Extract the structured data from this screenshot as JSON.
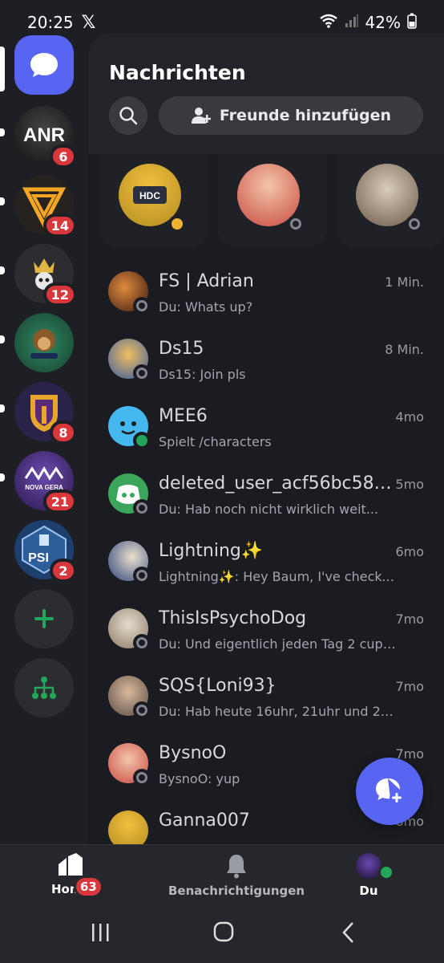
{
  "status_bar": {
    "time": "20:25",
    "battery": "42%"
  },
  "rail": {
    "servers": [
      {
        "name": "ANR",
        "badge": "6",
        "color": "#222"
      },
      {
        "name": "league",
        "badge": "14",
        "color": "#2a2420"
      },
      {
        "name": "crown-skull",
        "badge": "12",
        "color": "#2b2b2e"
      },
      {
        "name": "monkey",
        "badge": "",
        "color": "#1f4a3a"
      },
      {
        "name": "spartan",
        "badge": "8",
        "color": "#2b2450"
      },
      {
        "name": "NOVA GERA",
        "badge": "21",
        "color": "#3b2a6a"
      },
      {
        "name": "PSI",
        "badge": "2",
        "color": "#1d3f6e"
      }
    ]
  },
  "header": {
    "title": "Nachrichten",
    "add_friends_label": "Freunde hinzufügen"
  },
  "active_now": [
    {
      "name": "HDC MANAGER",
      "status": "idle"
    },
    {
      "name": "player",
      "status": "offline"
    },
    {
      "name": "dog",
      "status": "offline"
    }
  ],
  "dms": [
    {
      "name": "FS | Adrian",
      "time": "1 Min.",
      "preview": "Du: Whats up?",
      "status": "offline",
      "color": "#7a3b22"
    },
    {
      "name": "Ds15",
      "time": "8 Min.",
      "preview": "Ds15: Join pls",
      "status": "offline",
      "color": "#3a5aa0"
    },
    {
      "name": "MEE6",
      "time": "4mo",
      "preview": "Spielt /characters",
      "status": "online",
      "color": "#46b8f0"
    },
    {
      "name": "deleted_user_acf56bc587...",
      "time": "5mo",
      "preview": "Du: Hab noch nicht wirklich weit...",
      "status": "offline",
      "color": "#3ba55c"
    },
    {
      "name": "Lightning✨",
      "time": "6mo",
      "preview": "Lightning✨: Hey Baum, I've checked wi...",
      "status": "offline",
      "color": "#2c3f7a"
    },
    {
      "name": "ThisIsPsychoDog",
      "time": "7mo",
      "preview": "Du: Und eigentlich jeden Tag 2 cups d...",
      "status": "offline",
      "color": "#8b7a66"
    },
    {
      "name": "SQS{Loni93}",
      "time": "7mo",
      "preview": "Du: Hab heute 16uhr, 21uhr und 22u...",
      "status": "offline",
      "color": "#5a4d44"
    },
    {
      "name": "BysnoO",
      "time": "7mo",
      "preview": "BysnoO: yup",
      "status": "offline",
      "color": "#c94b43"
    },
    {
      "name": "Ganna007",
      "time": "8mo",
      "preview": "",
      "status": "offline",
      "color": "#b38b1f"
    }
  ],
  "bottom_nav": {
    "home": {
      "label": "Home",
      "badge": "63"
    },
    "notifications": {
      "label": "Benachrichtigungen"
    },
    "you": {
      "label": "Du"
    }
  }
}
